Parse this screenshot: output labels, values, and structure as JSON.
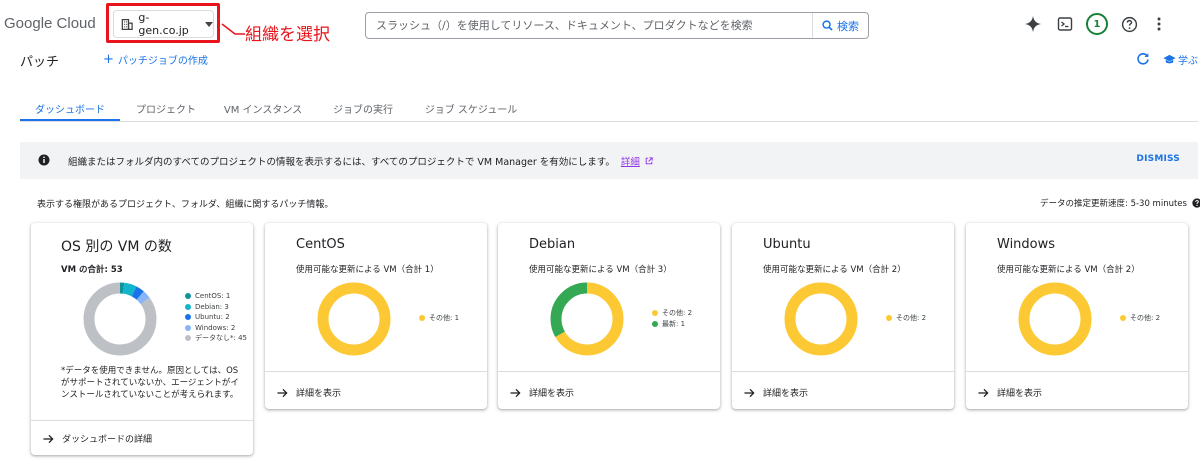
{
  "header": {
    "logo_google": "Google",
    "logo_cloud": " Cloud",
    "org": "g-gen.co.jp",
    "callout": "組織を選択",
    "search_placeholder": "スラッシュ（/）を使用してリソース、ドキュメント、プロダクトなどを検索",
    "search_button": "検索",
    "notification_count": "1",
    "icons": [
      "gemini-spark-icon",
      "cloud-shell-icon",
      "help-icon",
      "more-vert-icon"
    ]
  },
  "page": {
    "title": "パッチ",
    "create_link": "パッチジョブの作成",
    "learn": "学ぶ"
  },
  "tabs": [
    {
      "label": "ダッシュボード",
      "active": true
    },
    {
      "label": "プロジェクト",
      "active": false
    },
    {
      "label": "VM インスタンス",
      "active": false
    },
    {
      "label": "ジョブの実行",
      "active": false
    },
    {
      "label": "ジョブ スケジュール",
      "active": false
    }
  ],
  "banner": {
    "text": "組織またはフォルダ内のすべてのプロジェクトの情報を表示するには、すべてのプロジェクトで VM Manager を有効にします。",
    "link": "詳細",
    "dismiss": "DISMISS"
  },
  "info": {
    "permission_text": "表示する権限があるプロジェクト、フォルダ、組織に関するパッチ情報。",
    "update_rate": "データの推定更新速度: 5-30 minutes"
  },
  "colors": {
    "accent": "#1a73e8",
    "yellow": "#fcc934",
    "green": "#34a853",
    "centos": "#12939a",
    "debian": "#12b5cb",
    "ubuntu": "#1a73e8",
    "windows": "#8ab4f8",
    "nodata": "#bdc1c6"
  },
  "os_card": {
    "title": "OS 別の VM の数",
    "total": "VM の合計: 53",
    "legend": [
      {
        "label": "CentOS: 1",
        "value": 1,
        "color": "#12939a"
      },
      {
        "label": "Debian: 3",
        "value": 3,
        "color": "#12b5cb"
      },
      {
        "label": "Ubuntu: 2",
        "value": 2,
        "color": "#1a73e8"
      },
      {
        "label": "Windows: 2",
        "value": 2,
        "color": "#8ab4f8"
      },
      {
        "label": "データなし*: 45",
        "value": 45,
        "color": "#bdc1c6"
      }
    ],
    "note": "*データを使用できません。原因としては、OS がサポートされていないか、エージェントがインストールされていないことが考えられます。",
    "footer": "ダッシュボードの詳細"
  },
  "os_cards": [
    {
      "title": "CentOS",
      "subtitle": "使用可能な更新による VM（合計 1）",
      "legend": [
        {
          "label": "その他: 1",
          "value": 1,
          "color": "#fcc934"
        }
      ],
      "footer": "詳細を表示"
    },
    {
      "title": "Debian",
      "subtitle": "使用可能な更新による VM（合計 3）",
      "legend": [
        {
          "label": "その他: 2",
          "value": 2,
          "color": "#fcc934"
        },
        {
          "label": "最新: 1",
          "value": 1,
          "color": "#34a853"
        }
      ],
      "footer": "詳細を表示"
    },
    {
      "title": "Ubuntu",
      "subtitle": "使用可能な更新による VM（合計 2）",
      "legend": [
        {
          "label": "その他: 2",
          "value": 2,
          "color": "#fcc934"
        }
      ],
      "footer": "詳細を表示"
    },
    {
      "title": "Windows",
      "subtitle": "使用可能な更新による VM（合計 2）",
      "legend": [
        {
          "label": "その他: 2",
          "value": 2,
          "color": "#fcc934"
        }
      ],
      "footer": "詳細を表示"
    }
  ]
}
